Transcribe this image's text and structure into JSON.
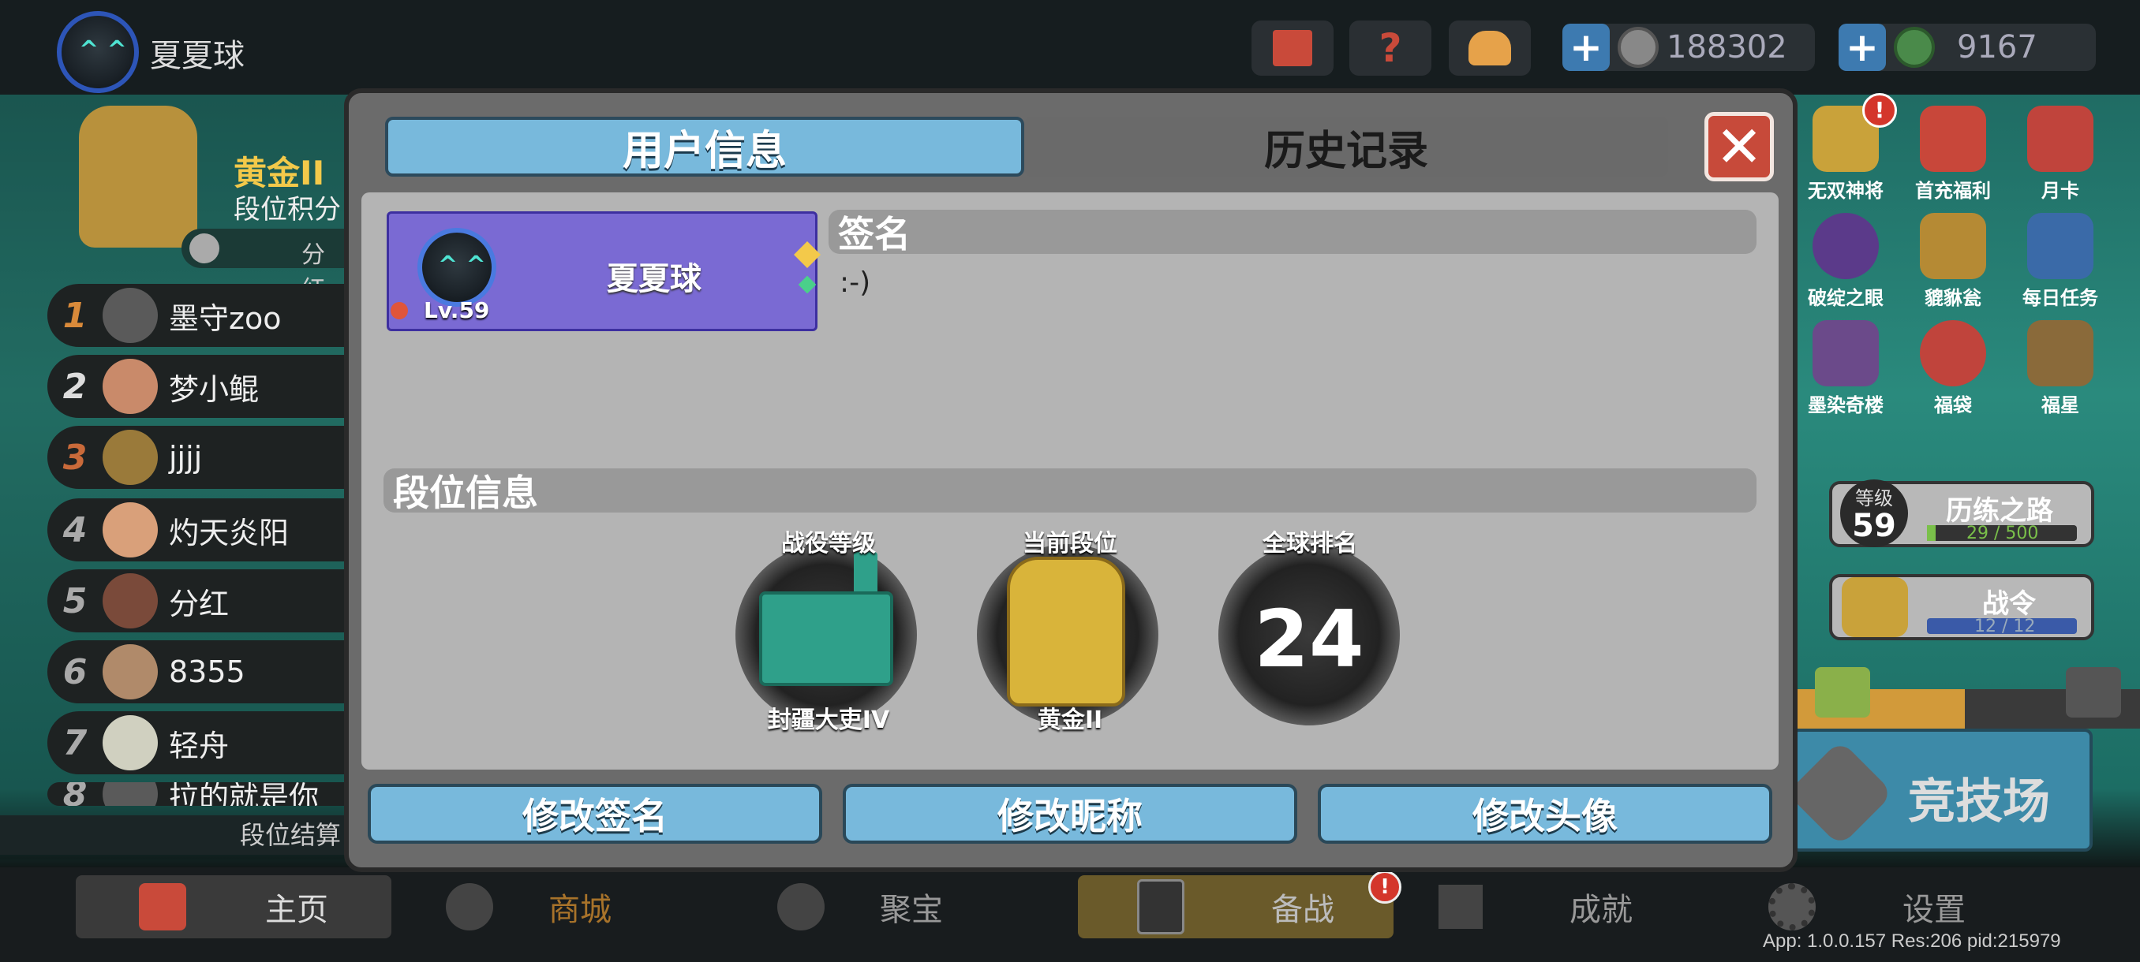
{
  "topbar": {
    "player_name": "夏夏球",
    "coins": "188302",
    "gems": "9167"
  },
  "left_panel": {
    "tier": "黄金II",
    "tier_sub": "段位积分",
    "points_label": "分红",
    "ranks": [
      {
        "num": "1",
        "name": "墨守zoo"
      },
      {
        "num": "2",
        "name": "梦小鲲"
      },
      {
        "num": "3",
        "name": "jjjj"
      },
      {
        "num": "4",
        "name": "灼天炎阳"
      },
      {
        "num": "5",
        "name": "分红"
      },
      {
        "num": "6",
        "name": "8355"
      },
      {
        "num": "7",
        "name": "轻舟"
      },
      {
        "num": "8",
        "name": "拉的就是你"
      }
    ],
    "footer": "段位结算"
  },
  "right_panel": {
    "icons": [
      {
        "label": "无双神将",
        "color": "#c9a23a"
      },
      {
        "label": "首充福利",
        "color": "#c8473a"
      },
      {
        "label": "月卡",
        "color": "#c0443c"
      },
      {
        "label": "破绽之眼",
        "color": "#5b3a8a"
      },
      {
        "label": "貔貅瓮",
        "color": "#b58a34"
      },
      {
        "label": "每日任务",
        "color": "#3a6aa8"
      },
      {
        "label": "墨染奇楼",
        "color": "#6b4a8a"
      },
      {
        "label": "福袋",
        "color": "#c0443c"
      },
      {
        "label": "福星",
        "color": "#8a6a3a"
      }
    ],
    "level_label": "等级",
    "level_value": "59",
    "trial_road": "历练之路",
    "trial_progress": "29 / 500",
    "battle_pass": "战令",
    "battle_pass_progress": "12 / 12",
    "arena": "竞技场"
  },
  "dialog": {
    "tabs": {
      "user_info": "用户信息",
      "history": "历史记录"
    },
    "close_icon": "close-icon",
    "card": {
      "name": "夏夏球",
      "level": "Lv.59"
    },
    "signature_title": "签名",
    "signature_text": ":-)",
    "rank_info_title": "段位信息",
    "badges": [
      {
        "top": "战役等级",
        "bottom": "封疆大吏IV"
      },
      {
        "top": "当前段位",
        "bottom": "黄金II"
      },
      {
        "top": "全球排名",
        "value": "24"
      }
    ],
    "actions": {
      "edit_signature": "修改签名",
      "edit_nickname": "修改昵称",
      "edit_avatar": "修改头像"
    }
  },
  "bottom_nav": {
    "home": "主页",
    "shop": "商城",
    "treasure": "聚宝",
    "prepare": "备战",
    "achievement": "成就",
    "settings": "设置"
  },
  "debug": "App: 1.0.0.157 Res:206 pid:215979"
}
